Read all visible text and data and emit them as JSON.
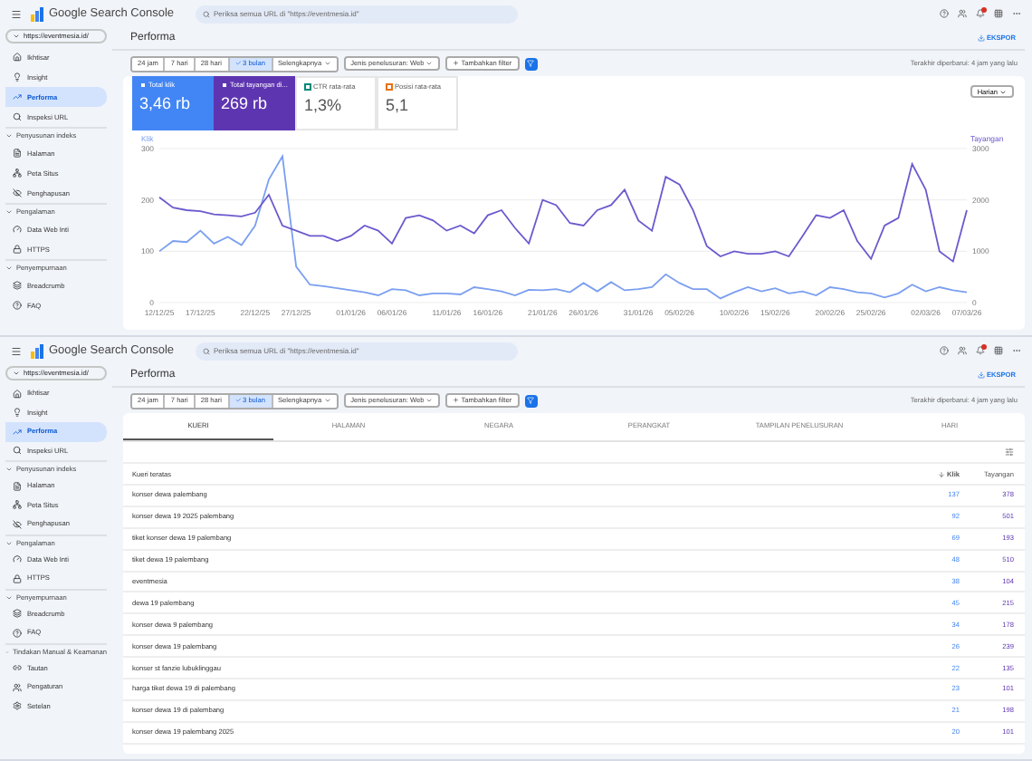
{
  "screens": [
    {
      "app_name": "Google Search Console",
      "search": {
        "placeholder": "Periksa semua URL di \"https://eventmesia.id\""
      },
      "property": "https://eventmesia.id/",
      "sections": [
        {
          "items": [
            {
              "label": "Ikhtisar",
              "selected": false
            },
            {
              "label": "Insight",
              "selected": false
            },
            {
              "label": "Performa",
              "selected": true
            },
            {
              "label": "Inspeksi URL",
              "selected": false
            }
          ]
        },
        {
          "title": "Penyusunan indeks",
          "items": [
            {
              "label": "Halaman",
              "selected": false
            },
            {
              "label": "Peta Situs",
              "selected": false
            },
            {
              "label": "Penghapusan",
              "selected": false
            }
          ]
        },
        {
          "title": "Pengalaman",
          "items": [
            {
              "label": "Data Web Inti",
              "selected": false
            },
            {
              "label": "HTTPS",
              "selected": false
            }
          ]
        },
        {
          "title": "Penyempurnaan",
          "items": [
            {
              "label": "Breadcrumb",
              "selected": false
            },
            {
              "label": "FAQ",
              "selected": false
            }
          ]
        }
      ],
      "page_title": "Performa",
      "export": "EKSPOR",
      "date_ranges": [
        {
          "label": "24 jam",
          "selected": false
        },
        {
          "label": "7 hari",
          "selected": false
        },
        {
          "label": "28 hari",
          "selected": false
        },
        {
          "label": "3 bulan",
          "selected": true
        },
        {
          "label": "Selengkapnya",
          "selected": false
        }
      ],
      "search_type": "Jenis penelusuran: Web",
      "add_filter": "Tambahkan filter",
      "updated": "Terakhir diperbarui: 4 jam yang lalu",
      "content": {
        "kind": "chart",
        "metrics": [
          {
            "label": "Total klik",
            "value": "3,46 rb",
            "selected": true,
            "color": "#4285f4"
          },
          {
            "label": "Total tayangan di...",
            "value": "269 rb",
            "selected": true,
            "color": "#5e35b1"
          },
          {
            "label": "CTR rata-rata",
            "value": "1,3%",
            "selected": false,
            "color": "#00897b"
          },
          {
            "label": "Posisi rata-rata",
            "value": "5,1",
            "selected": false,
            "color": "#e8710a"
          }
        ],
        "granularity": "Harian",
        "chart_data": {
          "type": "line",
          "ylim": [
            0,
            300
          ],
          "yticks": [
            0,
            100,
            200,
            300
          ],
          "y2lim": [
            0,
            3000
          ],
          "y2ticks": [
            0,
            1000,
            2000,
            3000
          ],
          "categories": [
            "12/12/25",
            null,
            null,
            "17/12/25",
            null,
            null,
            null,
            "22/12/25",
            null,
            null,
            "27/12/25",
            null,
            null,
            null,
            "01/01/26",
            null,
            null,
            "06/01/26",
            null,
            null,
            null,
            "11/01/26",
            null,
            null,
            "16/01/26",
            null,
            null,
            null,
            "21/01/26",
            null,
            null,
            "26/01/26",
            null,
            null,
            null,
            "31/01/26",
            null,
            null,
            "05/02/26",
            null,
            null,
            null,
            "10/02/26",
            null,
            null,
            "15/02/26",
            null,
            null,
            null,
            "20/02/26",
            null,
            null,
            "25/02/26",
            null,
            null,
            null,
            "02/03/26",
            null,
            null,
            "07/03/26"
          ],
          "series": [
            {
              "name": "Klik",
              "color": "#7b9ff0",
              "values": [
                100,
                120,
                118,
                140,
                115,
                128,
                112,
                150,
                240,
                285,
                70,
                35,
                32,
                28,
                24,
                20,
                14,
                26,
                24,
                14,
                18,
                18,
                16,
                30,
                26,
                22,
                14,
                25,
                24,
                26,
                20,
                38,
                22,
                40,
                24,
                26,
                30,
                55,
                38,
                26,
                26,
                8,
                20,
                30,
                22,
                28,
                18,
                22,
                14,
                30,
                26,
                20,
                18,
                10,
                18,
                35,
                22,
                30,
                24,
                20
              ]
            },
            {
              "name": "Tayangan",
              "color": "#6a5acd",
              "axis": "y2",
              "values": [
                2050,
                1850,
                1800,
                1780,
                1720,
                1700,
                1680,
                1750,
                2100,
                1500,
                1400,
                1300,
                1300,
                1200,
                1300,
                1500,
                1400,
                1150,
                1650,
                1700,
                1600,
                1400,
                1500,
                1350,
                1700,
                1800,
                1450,
                1150,
                2000,
                1900,
                1550,
                1500,
                1800,
                1900,
                2200,
                1600,
                1400,
                2450,
                2300,
                1800,
                1100,
                900,
                1000,
                950,
                950,
                1000,
                900,
                1300,
                1700,
                1650,
                1800,
                1200,
                850,
                1500,
                1650,
                2700,
                2200,
                1000,
                800,
                1800
              ]
            }
          ]
        }
      }
    },
    {
      "app_name": "Google Search Console",
      "search": {
        "placeholder": "Periksa semua URL di \"https://eventmesia.id\""
      },
      "property": "https://eventmesia.id/",
      "sections": [
        {
          "items": [
            {
              "label": "Ikhtisar",
              "selected": false
            },
            {
              "label": "Insight",
              "selected": false
            },
            {
              "label": "Performa",
              "selected": true
            },
            {
              "label": "Inspeksi URL",
              "selected": false
            }
          ]
        },
        {
          "title": "Penyusunan indeks",
          "items": [
            {
              "label": "Halaman",
              "selected": false
            },
            {
              "label": "Peta Situs",
              "selected": false
            },
            {
              "label": "Penghapusan",
              "selected": false
            }
          ]
        },
        {
          "title": "Pengalaman",
          "items": [
            {
              "label": "Data Web Inti",
              "selected": false
            },
            {
              "label": "HTTPS",
              "selected": false
            }
          ]
        },
        {
          "title": "Penyempurnaan",
          "items": [
            {
              "label": "Breadcrumb",
              "selected": false
            },
            {
              "label": "FAQ",
              "selected": false
            }
          ]
        },
        {
          "title": "Tindakan Manual & Keamanan",
          "items": [
            {
              "label": "Tautan",
              "selected": false
            },
            {
              "label": "Pengaturan",
              "selected": false
            },
            {
              "label": "Setelan",
              "selected": false
            }
          ]
        }
      ],
      "page_title": "Performa",
      "export": "EKSPOR",
      "date_ranges": [
        {
          "label": "24 jam",
          "selected": false
        },
        {
          "label": "7 hari",
          "selected": false
        },
        {
          "label": "28 hari",
          "selected": false
        },
        {
          "label": "3 bulan",
          "selected": true
        },
        {
          "label": "Selengkapnya",
          "selected": false
        }
      ],
      "search_type": "Jenis penelusuran: Web",
      "add_filter": "Tambahkan filter",
      "updated": "Terakhir diperbarui: 4 jam yang lalu",
      "content": {
        "kind": "table",
        "tabs": [
          {
            "label": "KUERI",
            "selected": true
          },
          {
            "label": "HALAMAN",
            "selected": false
          },
          {
            "label": "NEGARA",
            "selected": false
          },
          {
            "label": "PERANGKAT",
            "selected": false
          },
          {
            "label": "TAMPILAN PENELUSURAN",
            "selected": false
          },
          {
            "label": "HARI",
            "selected": false
          }
        ],
        "columns": [
          "Kueri teratas",
          "Klik",
          "Tayangan"
        ],
        "rows": [
          [
            "konser dewa palembang",
            "137",
            "378"
          ],
          [
            "konser dewa 19 2025 palembang",
            "92",
            "501"
          ],
          [
            "tiket konser dewa 19 palembang",
            "69",
            "193"
          ],
          [
            "tiket dewa 19 palembang",
            "48",
            "510"
          ],
          [
            "eventmesia",
            "38",
            "104"
          ],
          [
            "dewa 19 palembang",
            "45",
            "215"
          ],
          [
            "konser dewa 9 palembang",
            "34",
            "178"
          ],
          [
            "konser dewa 19 palembang",
            "26",
            "239"
          ],
          [
            "konser st fanzie lubuklinggau",
            "22",
            "135"
          ],
          [
            "harga tiket dewa 19 di palembang",
            "23",
            "101"
          ],
          [
            "konser dewa 19 di palembang",
            "21",
            "198"
          ],
          [
            "konser dewa 19 palembang 2025",
            "20",
            "101"
          ]
        ]
      }
    }
  ]
}
